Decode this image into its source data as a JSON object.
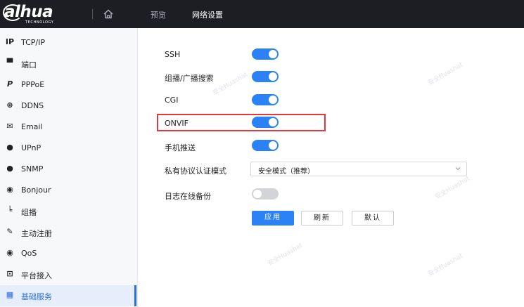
{
  "brand": {
    "name": "alhua",
    "tagline": "TECHNOLOGY"
  },
  "header": {
    "nav": [
      {
        "label": "预览"
      },
      {
        "label": "网络设置"
      }
    ]
  },
  "sidebar": {
    "items": [
      {
        "label": "TCP/IP",
        "icon": "ip-icon"
      },
      {
        "label": "端口",
        "icon": "port-icon"
      },
      {
        "label": "PPPoE",
        "icon": "pppoe-icon"
      },
      {
        "label": "DDNS",
        "icon": "globe-icon"
      },
      {
        "label": "Email",
        "icon": "email-icon"
      },
      {
        "label": "UPnP",
        "icon": "upnp-icon"
      },
      {
        "label": "SNMP",
        "icon": "snmp-icon"
      },
      {
        "label": "Bonjour",
        "icon": "bonjour-icon"
      },
      {
        "label": "组播",
        "icon": "multicast-icon"
      },
      {
        "label": "主动注册",
        "icon": "register-icon"
      },
      {
        "label": "QoS",
        "icon": "qos-icon"
      },
      {
        "label": "平台接入",
        "icon": "platform-icon"
      },
      {
        "label": "基础服务",
        "icon": "grid-icon"
      }
    ]
  },
  "settings": {
    "ssh": {
      "label": "SSH",
      "enabled": true
    },
    "multicast_search": {
      "label": "组播/广播搜索",
      "enabled": true
    },
    "cgi": {
      "label": "CGI",
      "enabled": true
    },
    "onvif": {
      "label": "ONVIF",
      "enabled": true
    },
    "mobile_push": {
      "label": "手机推送",
      "enabled": true
    },
    "auth_mode": {
      "label": "私有协议认证模式",
      "value": "安全模式（推荐）"
    },
    "log_backup": {
      "label": "日志在线备份",
      "enabled": false
    }
  },
  "buttons": {
    "apply": "应用",
    "refresh": "刷新",
    "default": "默认"
  },
  "colors": {
    "accent": "#2b82f6",
    "highlight": "#e0383e",
    "topbar": "#1d1e23"
  },
  "watermark": "安全Huashat"
}
